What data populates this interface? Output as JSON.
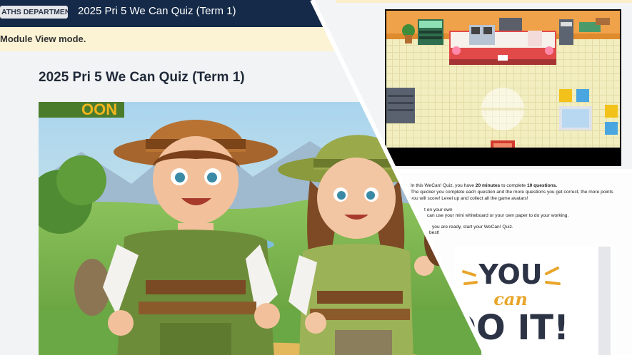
{
  "header": {
    "department_badge": "ATHS DEPARTMENT",
    "course_title": "2025 Pri 5 We Can Quiz (Term 1)",
    "background": "#152a48"
  },
  "notice": {
    "text": "Module View mode."
  },
  "page": {
    "title": "2025 Pri 5 We Can Quiz (Term 1)"
  },
  "instructions": {
    "line1_prefix": "In this WeCan! Quiz, you have ",
    "line1_time": "20 minutes",
    "line1_mid": " to complete ",
    "line1_count": "10 questions.",
    "line2": "The quicker you complete each question and the more questions you get correct, the more points",
    "line3": "you will score! Level up and collect all the game avatars!",
    "line4": "t on your own",
    "line5": "can use your mini whiteboard or your own paper to do your working.",
    "line6": "you are ready, start your WeCan! Quiz.",
    "line7": "best!"
  },
  "poster": {
    "line1": "YOU",
    "line2": "can",
    "line3": "DO IT!"
  }
}
